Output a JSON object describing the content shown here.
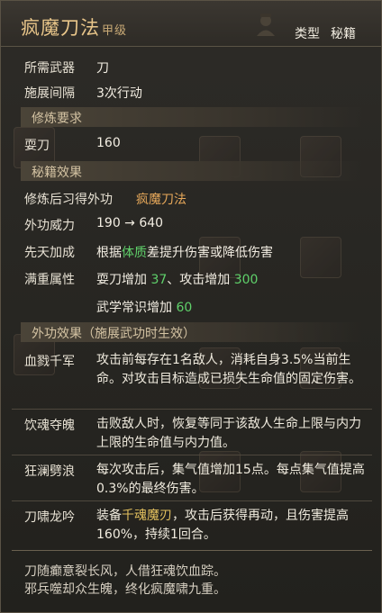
{
  "header": {
    "title": "疯魔刀法",
    "grade": "甲级",
    "type_label": "类型",
    "type_value": "秘籍"
  },
  "info": {
    "weapon_label": "所需武器",
    "weapon_value": "刀",
    "interval_label": "施展间隔",
    "interval_value": "3次行动"
  },
  "requirement": {
    "title": "修炼要求",
    "skill_label": "耍刀",
    "skill_value": "160"
  },
  "effects": {
    "title": "秘籍效果",
    "learn_label": "修炼后习得外功",
    "learn_value": "疯魔刀法",
    "power_label": "外功威力",
    "power_value": "190 → 640",
    "innate_label": "先天加成",
    "innate_pre": "根据",
    "innate_attr": "体质",
    "innate_post": "差提升伤害或降低伤害",
    "full_label": "满重属性",
    "full_1a": "耍刀增加 ",
    "full_1b": "37",
    "full_1c": "、攻击增加 ",
    "full_1d": "300",
    "full_2a": "武学常识增加 ",
    "full_2b": "60"
  },
  "combat": {
    "title": "外功效果（施展武功时生效）",
    "items": [
      {
        "name": "血戮千军",
        "text": "攻击前每存在1名敌人，消耗自身3.5%当前生命。对攻击目标造成已损失生命值的固定伤害。"
      },
      {
        "name": "饮魂夺魄",
        "text": "击败敌人时，恢复等同于该敌人生命上限与内力上限的生命值与内力值。"
      },
      {
        "name": "狂澜劈浪",
        "text": "每次攻击后，集气值增加15点。每点集气值提高0.3%的最终伤害。"
      },
      {
        "name": "刀啸龙吟",
        "text_a": "装备",
        "text_b": "千魂魔刃",
        "text_c": "，攻击后获得再动，且伤害提高160%，持续1回合。"
      }
    ]
  },
  "flavor": {
    "line1": "刀随癫意裂长风，人借狂魂饮血踪。",
    "line2": "邪兵噬却众生魄，终化疯魔啸九重。"
  },
  "colors": {
    "title": "#e9c68a",
    "orange": "#e6a85a",
    "green": "#5fd06a",
    "yellow": "#e3c05e"
  }
}
